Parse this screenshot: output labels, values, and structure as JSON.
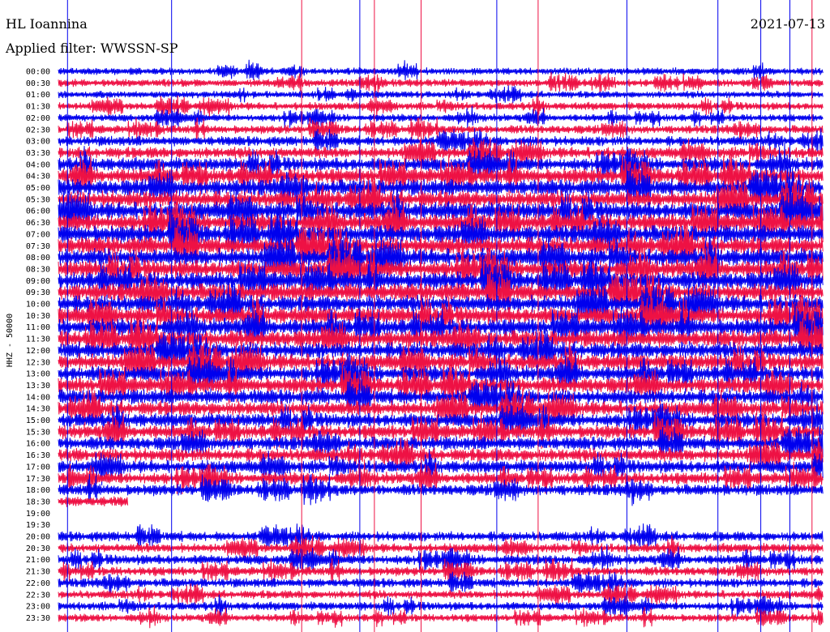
{
  "header": {
    "station": "HL Ioannina",
    "date": "2021-07-13",
    "filter_label": "Applied filter: WWSSN-SP"
  },
  "chart_data": {
    "type": "line",
    "title": "HL Ioannina",
    "subtitle": "Applied filter: WWSSN-SP",
    "ylabel": "HHZ - 50000",
    "xlabel": "",
    "row_labels": [
      "00:00",
      "00:30",
      "01:00",
      "01:30",
      "02:00",
      "02:30",
      "03:00",
      "03:30",
      "04:00",
      "04:30",
      "05:00",
      "05:30",
      "06:00",
      "06:30",
      "07:00",
      "07:30",
      "08:00",
      "08:30",
      "09:00",
      "09:30",
      "10:00",
      "10:30",
      "11:00",
      "11:30",
      "12:00",
      "12:30",
      "13:00",
      "13:30",
      "14:00",
      "14:30",
      "15:00",
      "15:30",
      "16:00",
      "16:30",
      "17:00",
      "17:30",
      "18:00",
      "18:30",
      "19:00",
      "19:30",
      "20:00",
      "20:30",
      "21:00",
      "21:30",
      "22:00",
      "22:30",
      "23:00",
      "23:30"
    ],
    "trace_colors": [
      "#0000ee",
      "#ee1144"
    ],
    "row_activity": [
      0.25,
      0.28,
      0.25,
      0.3,
      0.28,
      0.35,
      0.45,
      0.55,
      0.7,
      0.85,
      0.9,
      0.95,
      1.0,
      1.0,
      1.0,
      1.0,
      1.0,
      1.0,
      1.0,
      1.0,
      0.95,
      0.95,
      0.95,
      0.95,
      0.9,
      0.9,
      0.85,
      0.85,
      0.8,
      0.8,
      0.75,
      0.75,
      0.7,
      0.7,
      0.65,
      0.6,
      0.55,
      0.5,
      0,
      0,
      0.45,
      0.4,
      0.45,
      0.4,
      0.4,
      0.35,
      0.35,
      0.3
    ],
    "row_coverage": [
      [
        0,
        1
      ],
      [
        0,
        1
      ],
      [
        0,
        1
      ],
      [
        0,
        1
      ],
      [
        0,
        1
      ],
      [
        0,
        1
      ],
      [
        0,
        1
      ],
      [
        0,
        1
      ],
      [
        0,
        1
      ],
      [
        0,
        1
      ],
      [
        0,
        1
      ],
      [
        0,
        1
      ],
      [
        0,
        1
      ],
      [
        0,
        1
      ],
      [
        0,
        1
      ],
      [
        0,
        1
      ],
      [
        0,
        1
      ],
      [
        0,
        1
      ],
      [
        0,
        1
      ],
      [
        0,
        1
      ],
      [
        0,
        1
      ],
      [
        0,
        1
      ],
      [
        0,
        1
      ],
      [
        0,
        1
      ],
      [
        0,
        1
      ],
      [
        0,
        1
      ],
      [
        0,
        1
      ],
      [
        0,
        1
      ],
      [
        0,
        1
      ],
      [
        0,
        1
      ],
      [
        0,
        1
      ],
      [
        0,
        1
      ],
      [
        0,
        1
      ],
      [
        0,
        1
      ],
      [
        0,
        1
      ],
      [
        0,
        1
      ],
      [
        0,
        1
      ],
      [
        0,
        0.09
      ],
      [
        0,
        0
      ],
      [
        0.94,
        1
      ],
      [
        0,
        1
      ],
      [
        0,
        1
      ],
      [
        0,
        1
      ],
      [
        0,
        1
      ],
      [
        0,
        1
      ],
      [
        0,
        1
      ],
      [
        0,
        1
      ],
      [
        0,
        1
      ]
    ],
    "vertical_spikes": [
      {
        "t": 0.012,
        "color": "#0000ee"
      },
      {
        "t": 0.148,
        "color": "#0000ee"
      },
      {
        "t": 0.318,
        "color": "#ee1144"
      },
      {
        "t": 0.394,
        "color": "#0000ee"
      },
      {
        "t": 0.413,
        "color": "#ee1144"
      },
      {
        "t": 0.474,
        "color": "#ee1144"
      },
      {
        "t": 0.573,
        "color": "#0000ee"
      },
      {
        "t": 0.627,
        "color": "#ee1144"
      },
      {
        "t": 0.743,
        "color": "#0000ee"
      },
      {
        "t": 0.862,
        "color": "#0000ee"
      },
      {
        "t": 0.918,
        "color": "#0000ee"
      },
      {
        "t": 0.956,
        "color": "#0000ee"
      },
      {
        "t": 0.985,
        "color": "#ee1144"
      }
    ]
  }
}
